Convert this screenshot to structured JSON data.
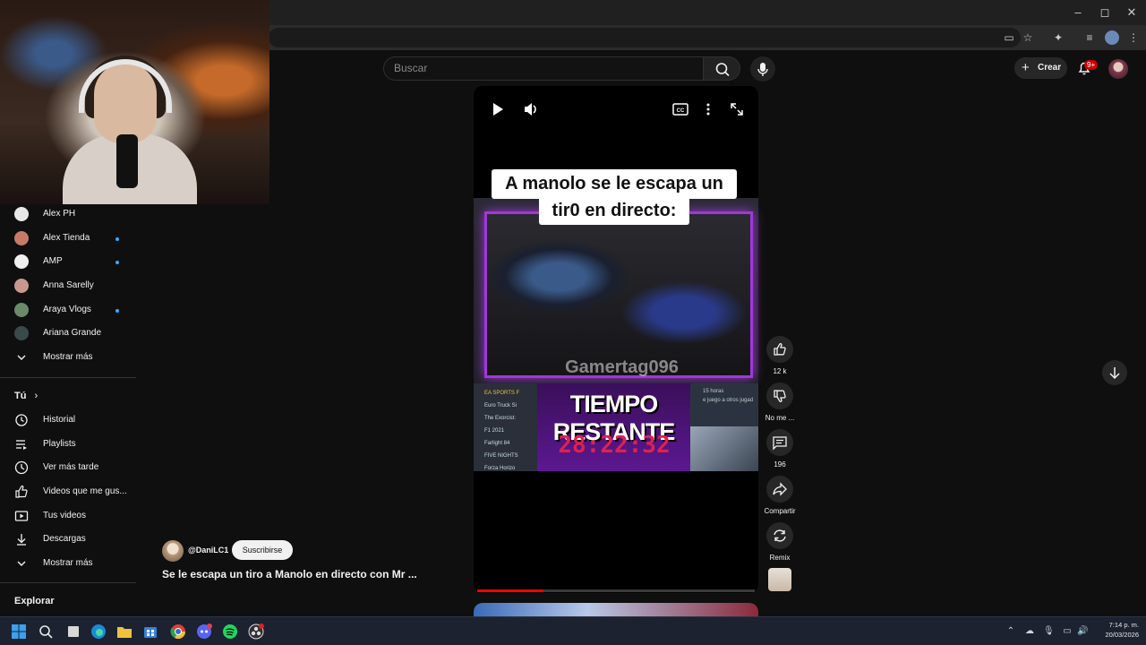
{
  "browser": {
    "minimize": "–",
    "maximize": "◻",
    "close": "✕"
  },
  "header": {
    "search_placeholder": "Buscar",
    "create_label": "Crear",
    "notifications_badge": "9+"
  },
  "sidebar": {
    "subscriptions": [
      {
        "name": "Alex PH",
        "new": false,
        "color": "#e8e8e8"
      },
      {
        "name": "Alex Tienda",
        "new": true,
        "color": "#c87a68"
      },
      {
        "name": "AMP",
        "new": true,
        "color": "#f0f0f0"
      },
      {
        "name": "Anna Sarelly",
        "new": false,
        "color": "#c89890"
      },
      {
        "name": "Araya Vlogs",
        "new": true,
        "color": "#6a8a6a"
      },
      {
        "name": "Ariana Grande",
        "new": false,
        "color": "#3a4a4a"
      }
    ],
    "show_more_1": "Mostrar más",
    "you_heading": "Tú",
    "you_items": [
      {
        "label": "Historial",
        "icon": "history-icon"
      },
      {
        "label": "Playlists",
        "icon": "playlists-icon"
      },
      {
        "label": "Ver más tarde",
        "icon": "watch-later-icon"
      },
      {
        "label": "Videos que me gus...",
        "icon": "like-icon"
      },
      {
        "label": "Tus videos",
        "icon": "your-videos-icon"
      },
      {
        "label": "Descargas",
        "icon": "download-icon"
      }
    ],
    "show_more_2": "Mostrar más",
    "explore_heading": "Explorar"
  },
  "video": {
    "overlay_title_line1": "A manolo se le escapa un",
    "overlay_title_line2": "tir0 en directo:",
    "gamertag": "Gamertag096",
    "banner": "TIEMPO RESTANTE",
    "timer": "28:22:32",
    "game_list": [
      "EA SPORTS F",
      "Euro Truck Si",
      "The Exorcist:",
      "F1 2021",
      "Farlight 84",
      "FIVE NIGHTS",
      "Forza Horizo"
    ],
    "chat_lines": [
      "15 horas",
      "e juego a otros jugad"
    ],
    "progress_fraction": 0.24
  },
  "actions": {
    "likes": "12 k",
    "dislike": "No me ...",
    "comments": "196",
    "share": "Compartir",
    "remix": "Remix"
  },
  "info": {
    "channel_handle": "@DaniLC1",
    "subscribe_label": "Suscribirse",
    "title": "Se le escapa un tiro a Manolo en directo con Mr ..."
  },
  "taskbar": {
    "time": "7:14 p. m.",
    "date": "20/03/2026"
  }
}
